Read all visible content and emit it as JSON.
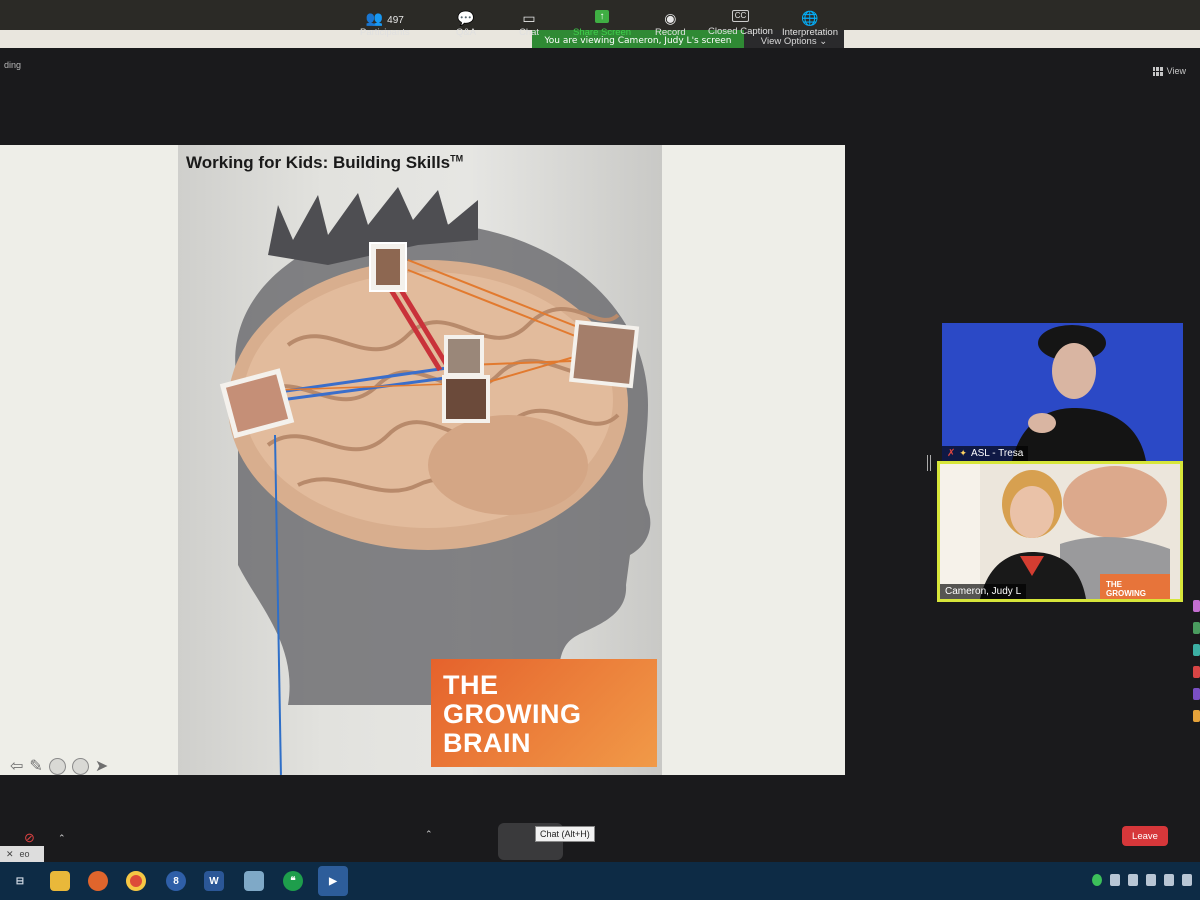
{
  "banner": {
    "viewing_text": "You are viewing Cameron, Judy L's screen",
    "options_label": "View Options ⌄"
  },
  "window": {
    "top_label": "ding",
    "view_label": "View"
  },
  "slide": {
    "title": "Working for Kids: Building Skills",
    "trademark": "TM",
    "brand_lines": [
      "THE",
      "GROWING",
      "BRAIN"
    ]
  },
  "tiles": [
    {
      "name": "ASL - Tresa",
      "muted": true,
      "pinned": true
    },
    {
      "name": "Cameron, Judy L",
      "active_speaker": true,
      "thumb_text": [
        "THE",
        "GROWING"
      ]
    }
  ],
  "toolbar": {
    "video_label": "eo",
    "participants_count": "497",
    "participants_label": "Participants",
    "qa_label": "Q&A",
    "chat_label": "Chat",
    "chat_tooltip": "Chat (Alt+H)",
    "share_label": "Share Screen",
    "record_label": "Record",
    "cc_icon_text": "CC",
    "cc_label": "Closed Caption",
    "interp_label": "Interpretation",
    "leave_label": "Leave"
  },
  "taskbar": {
    "apps": [
      "task-view",
      "file-explorer",
      "firefox",
      "chrome",
      "app-8",
      "word",
      "notepad",
      "hangouts",
      "zoom"
    ]
  },
  "colors": {
    "accent_green": "#2f8a34",
    "leave_red": "#d6373a",
    "speaker_border": "#d7e63a",
    "brand_orange": "#e5622c"
  }
}
